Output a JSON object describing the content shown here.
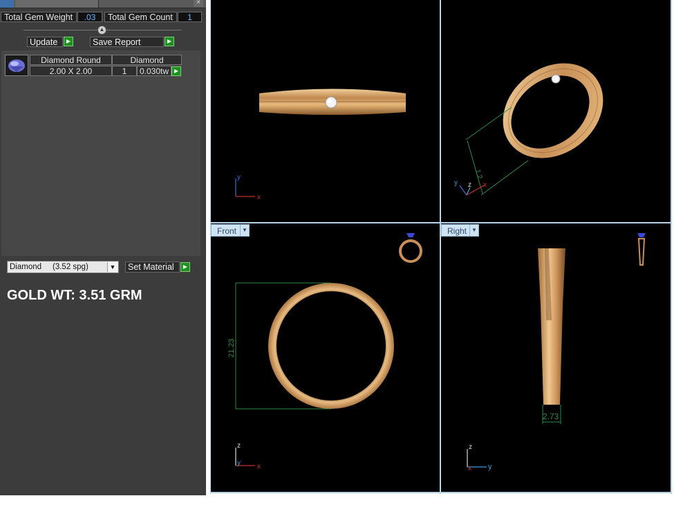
{
  "left_panel": {
    "total_gem_weight_label": "Total Gem Weight",
    "total_gem_weight_value": ".03",
    "total_gem_count_label": "Total Gem Count",
    "total_gem_count_value": "1",
    "update_button": "Update",
    "save_report_button": "Save Report",
    "gem_table": {
      "headers": [
        "Diamond Round",
        "Diamond"
      ],
      "row": {
        "size": "2.00 X 2.00",
        "count": "1",
        "weight": "0.030tw"
      }
    },
    "material_select": "Diamond     (3.52 spg)",
    "set_material_button": "Set Material",
    "gold_weight": "GOLD WT: 3.51 GRM"
  },
  "viewports": {
    "top_left": {
      "axes": [
        "y",
        "x"
      ]
    },
    "top_right": {
      "dimension": "1.2",
      "axes": [
        "y",
        "z",
        "x"
      ]
    },
    "front": {
      "tab": "Front",
      "dimension": "21.23",
      "axes": [
        "z",
        "y",
        "x"
      ]
    },
    "right": {
      "tab": "Right",
      "dimension": "2.73",
      "axes": [
        "z",
        "x",
        "y"
      ]
    }
  },
  "colors": {
    "panel_bg": "#3c3c3c",
    "viewport_bg": "#000000",
    "gold": "#d9a86a",
    "dimension_green": "#2e8b4a",
    "accent_blue": "#6ab4ff"
  }
}
